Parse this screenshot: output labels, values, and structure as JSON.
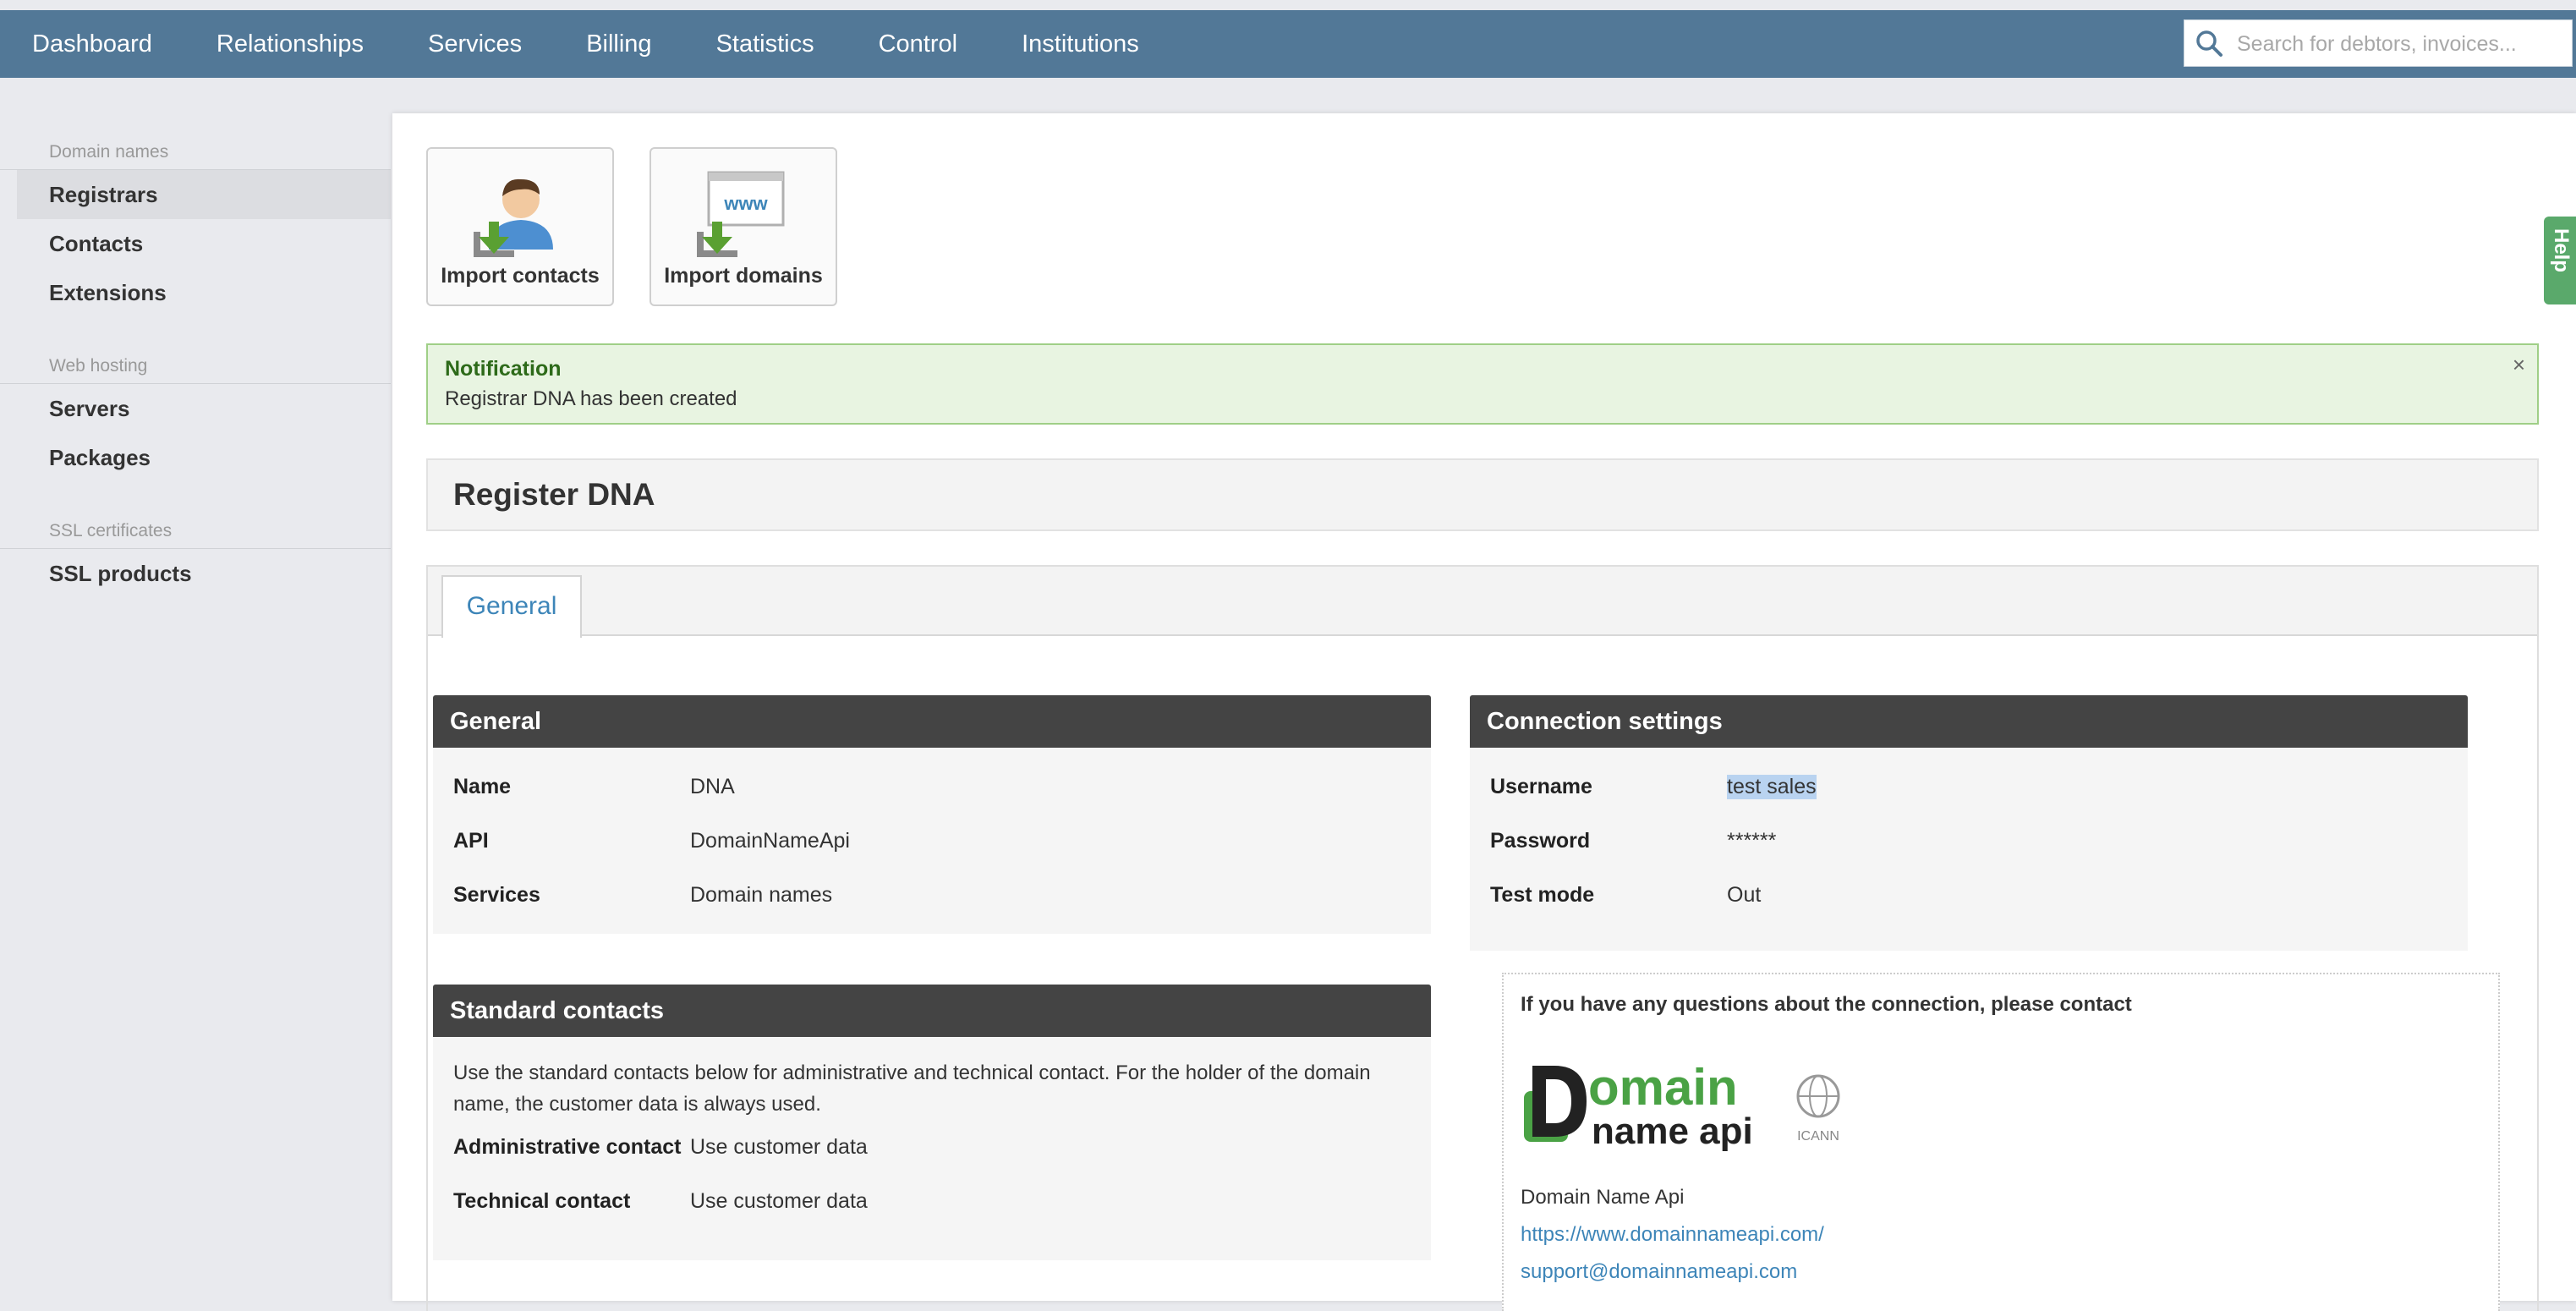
{
  "nav": {
    "items": [
      "Dashboard",
      "Relationships",
      "Services",
      "Billing",
      "Statistics",
      "Control",
      "Institutions"
    ],
    "search_placeholder": "Search for debtors, invoices..."
  },
  "sidebar": {
    "groups": [
      {
        "heading": "Domain names",
        "items": [
          "Registrars",
          "Contacts",
          "Extensions"
        ]
      },
      {
        "heading": "Web hosting",
        "items": [
          "Servers",
          "Packages"
        ]
      },
      {
        "heading": "SSL certificates",
        "items": [
          "SSL products"
        ]
      }
    ],
    "active": "Registrars"
  },
  "actions": {
    "import_contacts": "Import contacts",
    "import_domains": "Import domains"
  },
  "notification": {
    "title": "Notification",
    "message": "Registrar DNA has been created",
    "close": "×"
  },
  "page_title": "Register DNA",
  "tabs": [
    "General"
  ],
  "general": {
    "title": "General",
    "rows": [
      {
        "label": "Name",
        "value": "DNA"
      },
      {
        "label": "API",
        "value": "DomainNameApi"
      },
      {
        "label": "Services",
        "value": "Domain names"
      }
    ]
  },
  "connection": {
    "title": "Connection settings",
    "rows": [
      {
        "label": "Username",
        "value": "test sales"
      },
      {
        "label": "Password",
        "value": "******"
      },
      {
        "label": "Test mode",
        "value": "Out"
      }
    ]
  },
  "standard_contacts": {
    "title": "Standard contacts",
    "description": "Use the standard contacts below for administrative and technical contact. For the holder of the domain name, the customer data is always used.",
    "rows": [
      {
        "label": "Administrative contact",
        "value": "Use customer data"
      },
      {
        "label": "Technical contact",
        "value": "Use customer data"
      }
    ]
  },
  "contact_box": {
    "question": "If you have any questions about the connection, please contact",
    "logo_text": "Domain name api",
    "icann": "ICANN",
    "name": "Domain Name Api",
    "url": "https://www.domainnameapi.com/",
    "email": "support@domainnameapi.com"
  },
  "help_tab": "Help",
  "colors": {
    "topbar": "#527897",
    "link": "#3d85b8",
    "panel_header": "#444444",
    "notification_bg": "#e8f4e1",
    "logo_green": "#4aa245"
  }
}
